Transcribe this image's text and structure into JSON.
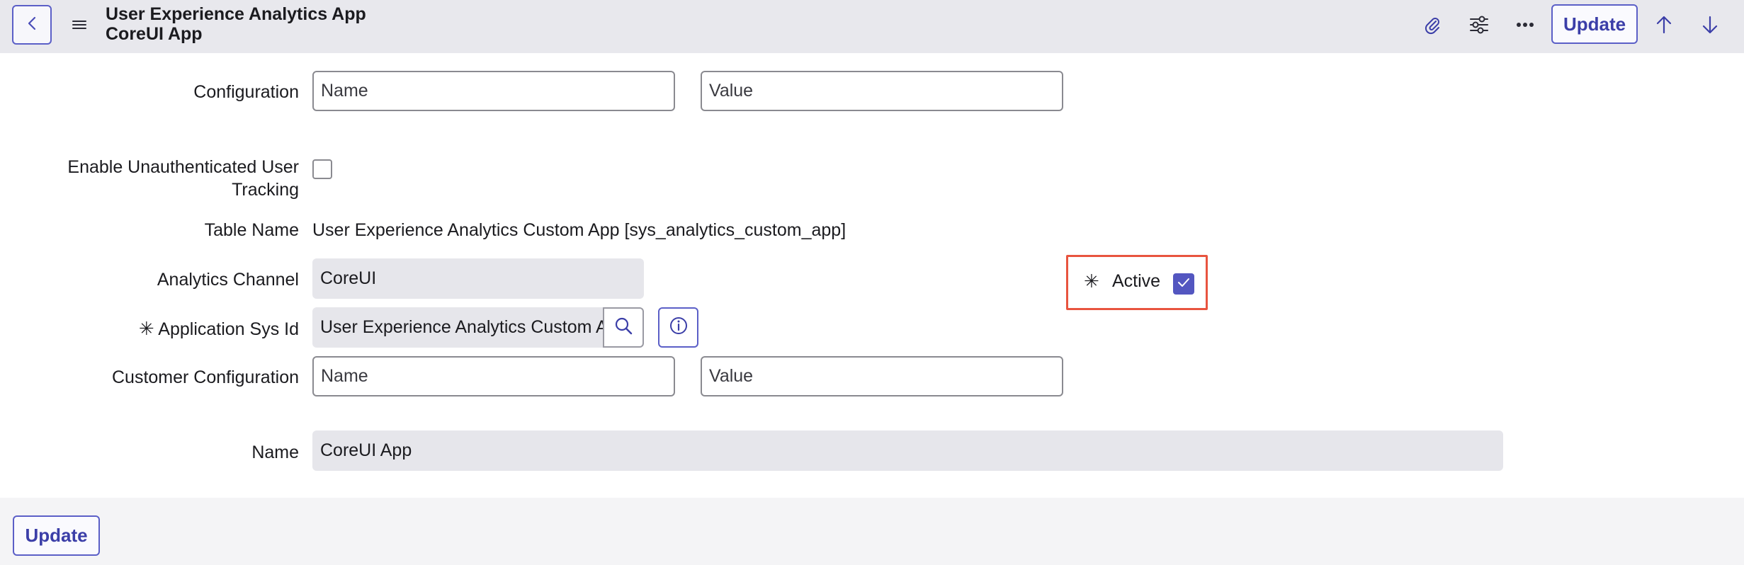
{
  "header": {
    "title_line1": "User Experience Analytics App",
    "title_line2": "CoreUI App",
    "update_label": "Update"
  },
  "form": {
    "configuration": {
      "label": "Configuration",
      "name_placeholder": "Name",
      "value_placeholder": "Value"
    },
    "enable_tracking": {
      "label_line1": "Enable Unauthenticated User",
      "label_line2": "Tracking",
      "checked": false
    },
    "table_name": {
      "label": "Table Name",
      "value": "User Experience Analytics Custom App [sys_analytics_custom_app]"
    },
    "analytics_channel": {
      "label": "Analytics Channel",
      "value": "CoreUI"
    },
    "active": {
      "asterisk": "✳",
      "label": "Active",
      "checked": true
    },
    "application_sys_id": {
      "asterisk": "✳",
      "label": "Application Sys Id",
      "value": "User Experience Analytics Custom A"
    },
    "customer_configuration": {
      "label": "Customer Configuration",
      "name_placeholder": "Name",
      "value_placeholder": "Value"
    },
    "name": {
      "label": "Name",
      "value": "CoreUI App"
    }
  },
  "footer": {
    "update_label": "Update"
  },
  "colors": {
    "accent": "#5b5fc7",
    "highlight": "#e8543f",
    "header_bg": "#e8e8ed"
  }
}
